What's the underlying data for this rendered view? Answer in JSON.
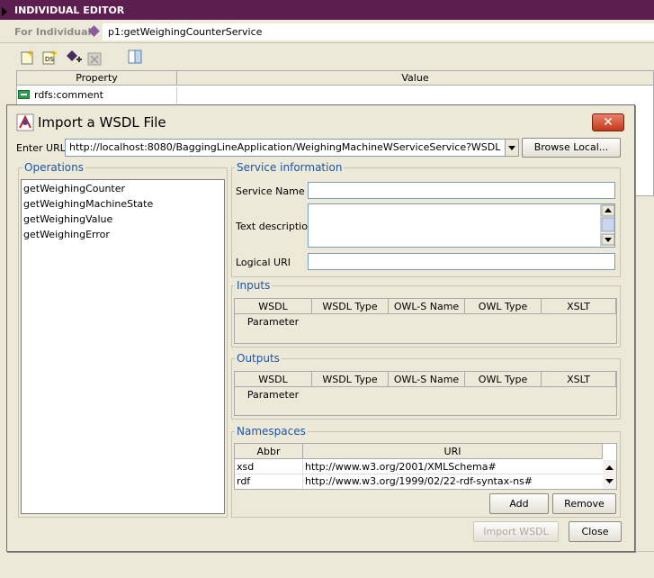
{
  "editor": {
    "title": "INDIVIDUAL EDITOR",
    "for_label": "For Individual:",
    "individual": "p1:getWeighingCounterService",
    "table_headers": {
      "property": "Property",
      "value": "Value"
    },
    "rows": [
      {
        "property": "rdfs:comment",
        "value": ""
      }
    ]
  },
  "dialog": {
    "title": "Import a WSDL File",
    "close_glyph": "✕",
    "url_label": "Enter URL:",
    "url_value": "http://localhost:8080/BaggingLineApplication/WeighingMachineWServiceService?WSDL",
    "browse_label": "Browse Local...",
    "operations": {
      "title": "Operations",
      "items": [
        "getWeighingCounter",
        "getWeighingMachineState",
        "getWeighingValue",
        "getWeighingError"
      ]
    },
    "service_info": {
      "title": "Service information",
      "name_label": "Service Name",
      "name_value": "",
      "desc_label": "Text description",
      "desc_value": "",
      "uri_label": "Logical URI",
      "uri_value": ""
    },
    "inputs": {
      "title": "Inputs",
      "columns": [
        "WSDL Parameter",
        "WSDL Type",
        "OWL-S Name",
        "OWL Type",
        "XSLT"
      ]
    },
    "outputs": {
      "title": "Outputs",
      "columns": [
        "WSDL Parameter",
        "WSDL Type",
        "OWL-S Name",
        "OWL Type",
        "XSLT"
      ]
    },
    "namespaces": {
      "title": "Namespaces",
      "columns": [
        "Abbr",
        "URI"
      ],
      "rows": [
        {
          "abbr": "xsd",
          "uri": "http://www.w3.org/2001/XMLSchema#"
        },
        {
          "abbr": "rdf",
          "uri": "http://www.w3.org/1999/02/22-rdf-syntax-ns#"
        }
      ],
      "add_label": "Add",
      "remove_label": "Remove"
    },
    "import_label": "Import WSDL",
    "close_label": "Close"
  }
}
